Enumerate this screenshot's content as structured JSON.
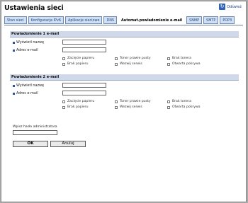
{
  "title": "Ustawienia sieci",
  "refresh_label": "Odśwież",
  "tabs": [
    {
      "label": "Stan sieci"
    },
    {
      "label": "Konfiguracja IPv6"
    },
    {
      "label": "Aplikacje sieciowe"
    },
    {
      "label": "DNS"
    },
    {
      "label": "Automat.powiadomienie e-mail",
      "active": true
    },
    {
      "label": "SNMP"
    },
    {
      "label": "SMTP"
    },
    {
      "label": "POP3"
    }
  ],
  "sections": [
    {
      "heading": "Powiadomienie 1 e-mail",
      "fields": [
        {
          "label": "Wyświetl nazwę",
          "value": ""
        },
        {
          "label": "Adres e-mail",
          "value": ""
        }
      ],
      "checkboxes": [
        [
          "Zacięcie papieru",
          "Toner prawie pusty",
          "Brak tonera"
        ],
        [
          "Brak papieru",
          "Wezwij serwis",
          "Otwarta pokrywa"
        ]
      ]
    },
    {
      "heading": "Powiadomienie 2 e-mail",
      "fields": [
        {
          "label": "Wyświetl nazwę",
          "value": ""
        },
        {
          "label": "Adres e-mail",
          "value": ""
        }
      ],
      "checkboxes": [
        [
          "Zacięcie papieru",
          "Toner prawie pusty",
          "Brak tonera"
        ],
        [
          "Brak papieru",
          "Wezwij serwis",
          "Otwarta pokrywa"
        ]
      ]
    }
  ],
  "admin": {
    "label": "Wpisz hasło administratora",
    "value": ""
  },
  "buttons": {
    "ok": "OK",
    "cancel": "Anuluj"
  },
  "colors": {
    "tab_bg": "#cfe0f5",
    "section_bg": "#cfd9ea",
    "accent": "#2b55a0"
  }
}
